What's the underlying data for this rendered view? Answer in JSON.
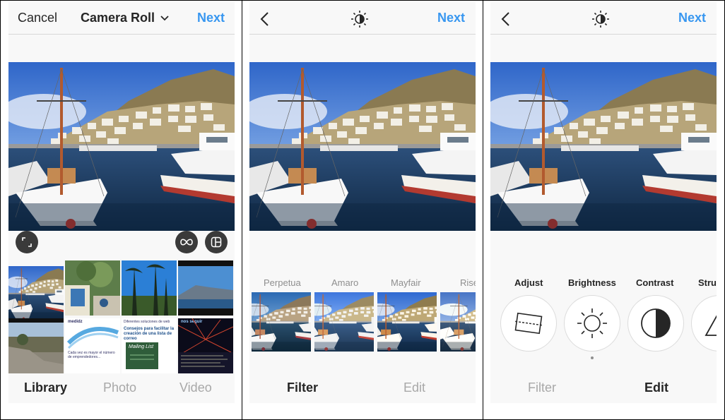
{
  "screen1": {
    "header": {
      "cancel_label": "Cancel",
      "title": "Camera Roll",
      "next_label": "Next"
    },
    "gallery_text": {
      "t6_heading": "medidz",
      "t6_body": "Cada vez es mayor el número de emprendedores...",
      "t7_top": "Diferentes soluciones de web",
      "t7_heading": "Consejos para facilitar la creación de una lista de correo",
      "t7_sign": "Mailing List",
      "t8_heading": "nos seguir"
    },
    "tabs": [
      {
        "label": "Library",
        "active": true
      },
      {
        "label": "Photo",
        "active": false
      },
      {
        "label": "Video",
        "active": false
      }
    ]
  },
  "screen2": {
    "header": {
      "next_label": "Next"
    },
    "filters": [
      "Perpetua",
      "Amaro",
      "Mayfair",
      "Rise"
    ],
    "tabs": [
      {
        "label": "Filter",
        "active": true
      },
      {
        "label": "Edit",
        "active": false
      }
    ]
  },
  "screen3": {
    "header": {
      "next_label": "Next"
    },
    "tools": [
      "Adjust",
      "Brightness",
      "Contrast",
      "Structure"
    ],
    "tabs": [
      {
        "label": "Filter",
        "active": false
      },
      {
        "label": "Edit",
        "active": true
      }
    ]
  },
  "icons": {
    "back": "chevron-left-icon",
    "lux": "sun-icon",
    "expand": "expand-icon",
    "boomerang": "infinity-icon",
    "layout": "layout-icon"
  },
  "colors": {
    "accent": "#3897f0",
    "text": "#262626",
    "inactive": "#a8a8a8"
  }
}
